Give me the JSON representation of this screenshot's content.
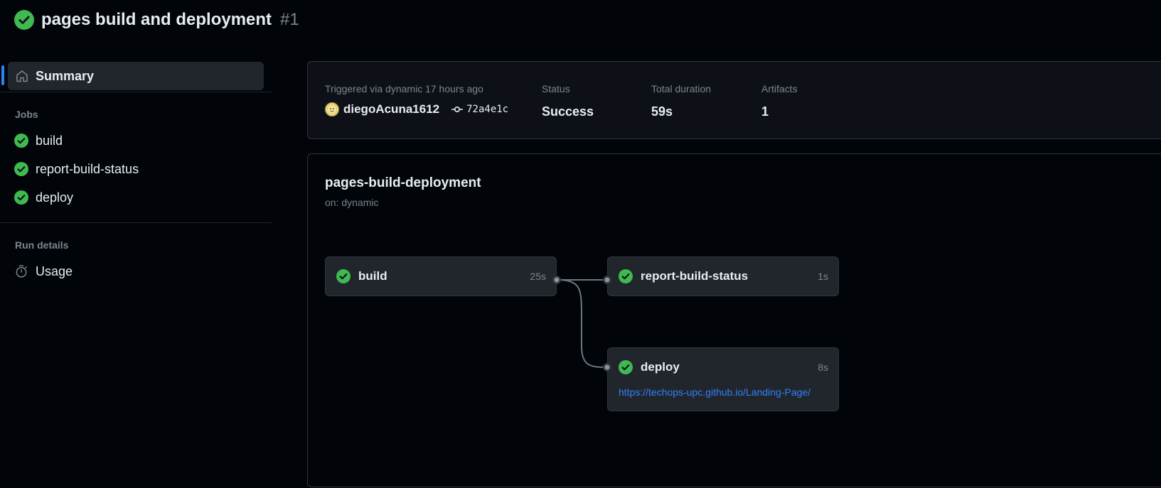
{
  "header": {
    "title": "pages build and deployment",
    "run_number": "#1",
    "status_icon": "check-circle-icon"
  },
  "sidebar": {
    "summary_label": "Summary",
    "jobs_heading": "Jobs",
    "jobs": [
      {
        "label": "build"
      },
      {
        "label": "report-build-status"
      },
      {
        "label": "deploy"
      }
    ],
    "run_details_heading": "Run details",
    "usage_label": "Usage"
  },
  "summary": {
    "triggered_label": "Triggered via dynamic 17 hours ago",
    "actor": "diegoAcuna1612",
    "commit": "72a4e1c",
    "status_label": "Status",
    "status_value": "Success",
    "duration_label": "Total duration",
    "duration_value": "59s",
    "artifacts_label": "Artifacts",
    "artifacts_value": "1"
  },
  "workflow": {
    "name": "pages-build-deployment",
    "trigger": "on: dynamic",
    "jobs": {
      "build": {
        "name": "build",
        "duration": "25s"
      },
      "report": {
        "name": "report-build-status",
        "duration": "1s"
      },
      "deploy": {
        "name": "deploy",
        "duration": "8s",
        "url": "https://techops-upc.github.io/Landing-Page/"
      }
    }
  },
  "colors": {
    "success": "#3fb950",
    "accent": "#2f81f7",
    "background": "#010409",
    "surface": "#21262d"
  }
}
